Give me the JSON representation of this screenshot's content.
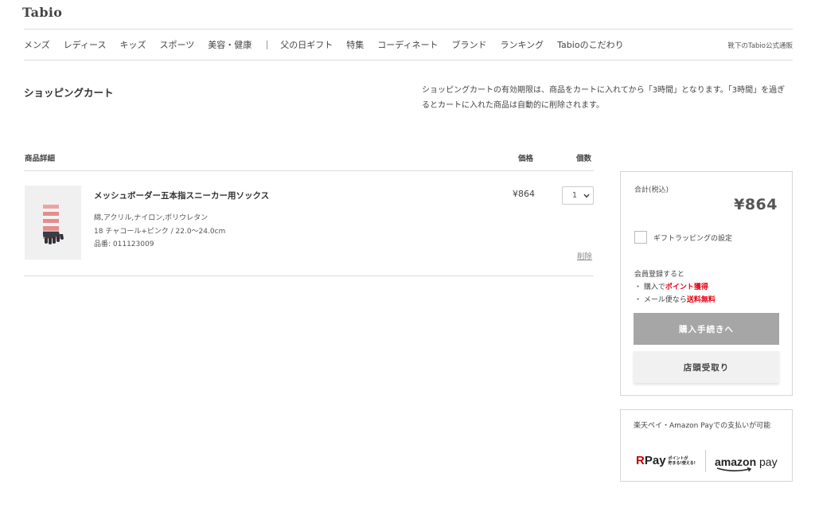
{
  "header": {
    "logo": "Tabio",
    "nav": [
      "メンズ",
      "レディース",
      "キッズ",
      "スポーツ",
      "美容・健康",
      "父の日ギフト",
      "特集",
      "コーディネート",
      "ブランド",
      "ランキング",
      "Tabioのこだわり"
    ],
    "right_label": "靴下のTabio公式通販"
  },
  "page": {
    "title": "ショッピングカート",
    "notice": "ショッピングカートの有効期限は、商品をカートに入れてから「3時間」となります。「3時間」を過ぎるとカートに入れた商品は自動的に削除されます。"
  },
  "cart": {
    "columns": {
      "detail": "商品詳細",
      "price": "価格",
      "qty": "個数"
    },
    "item": {
      "name": "メッシュボーダー五本指スニーカー用ソックス",
      "material": "綿,アクリル,ナイロン,ポリウレタン",
      "variant": "18 チャコール+ピンク / 22.0〜24.0cm",
      "sku": "品番: 011123009",
      "price": "¥864",
      "qty": "1",
      "delete": "削除"
    }
  },
  "summary": {
    "label": "合計(税込)",
    "total": "¥864",
    "gift_label": "ギフトラッピングの設定",
    "member_title": "会員登録すると",
    "member_line1_prefix": "・ 購入で",
    "member_line1_highlight": "ポイント獲得",
    "member_line2_prefix": "・ メール便なら",
    "member_line2_highlight": "送料無料",
    "buy_button": "購入手続きへ",
    "store_button": "店頭受取り"
  },
  "payment": {
    "text": "楽天ペイ・Amazon Payでの支払いが可能",
    "rakuten_r": "R",
    "rakuten_pay": "Pay",
    "rakuten_note_1": "ポイントが",
    "rakuten_note_2": "貯まる!使える!",
    "amazon_word": "amazon",
    "amazon_pay": "pay"
  },
  "colors": {
    "accent_red": "#e60012",
    "buy_button_bg": "#a6a6a6",
    "border": "#d6d6d6",
    "rakuten_red": "#bf0000"
  }
}
